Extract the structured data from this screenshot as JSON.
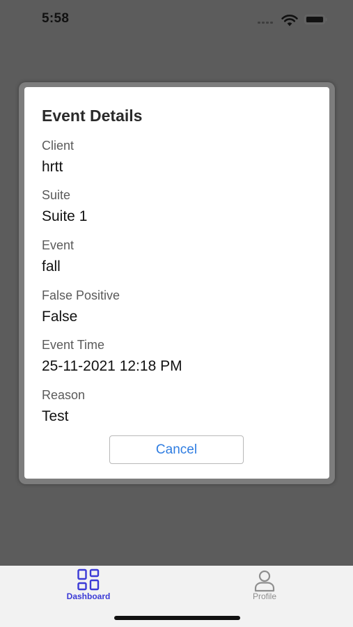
{
  "status_bar": {
    "time": "5:58"
  },
  "dialog": {
    "title": "Event Details",
    "fields": [
      {
        "label": "Client",
        "value": "hrtt"
      },
      {
        "label": "Suite",
        "value": "Suite 1"
      },
      {
        "label": "Event",
        "value": "fall"
      },
      {
        "label": "False Positive",
        "value": "False"
      },
      {
        "label": "Event Time",
        "value": "25-11-2021 12:18 PM"
      },
      {
        "label": "Reason",
        "value": "Test"
      }
    ],
    "cancel_label": "Cancel"
  },
  "tab_bar": {
    "tabs": [
      {
        "label": "Dashboard",
        "icon": "dashboard-icon",
        "active": true
      },
      {
        "label": "Profile",
        "icon": "profile-icon",
        "active": false
      }
    ]
  },
  "colors": {
    "overlay": "#5c5c5c",
    "accent": "#2f7de1",
    "tab_active": "#3b3ad6",
    "tab_inactive": "#8e8e8e"
  }
}
